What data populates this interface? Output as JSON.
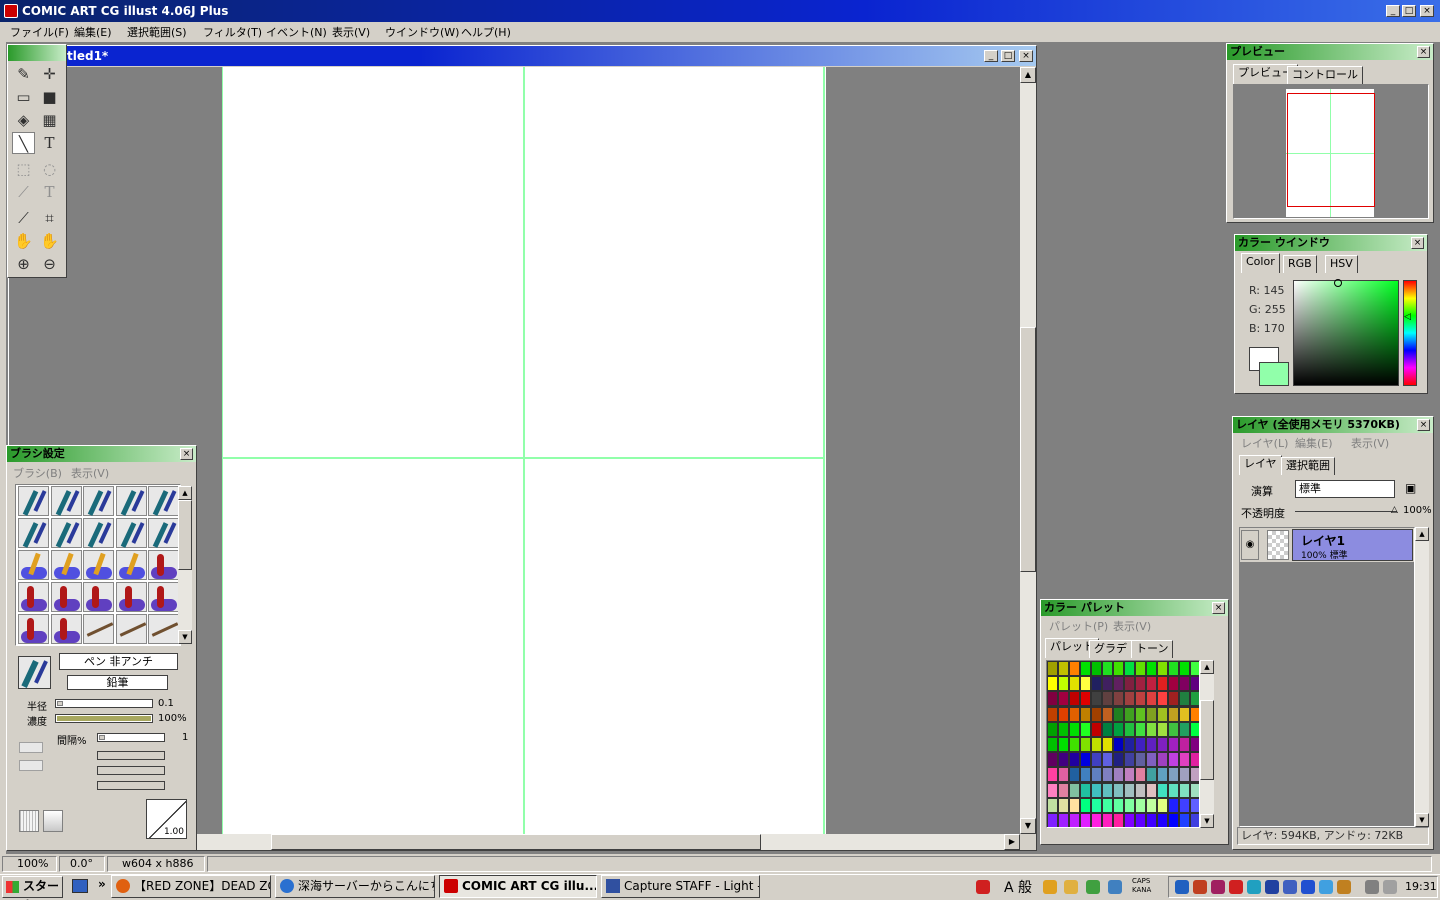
{
  "app": {
    "title": "COMIC ART CG illust 4.06J Plus",
    "menu": [
      "ファイル(F)",
      "編集(E)",
      "選択範囲(S)",
      "フィルタ(T)",
      "イベント(N)",
      "表示(V)",
      "ウインドウ(W)",
      "ヘルプ(H)"
    ]
  },
  "doc": {
    "title": "tled1*"
  },
  "status": {
    "zoom": "100%",
    "angle": "0.0°",
    "size": "w604 x h886"
  },
  "preview": {
    "title": "プレビュー",
    "tabs": [
      "プレビュー",
      "コントロール"
    ]
  },
  "color": {
    "title": "カラー ウインドウ",
    "tabs": [
      "Color",
      "RGB",
      "HSV"
    ],
    "r": "R: 145",
    "g": "G: 255",
    "b": "B: 170",
    "current": "#91ffaa"
  },
  "layer": {
    "title": "レイヤ (全使用メモリ 5370KB)",
    "menu": [
      "レイヤ(L)",
      "編集(E)",
      "表示(V)"
    ],
    "tabs": [
      "レイヤ",
      "選択範囲"
    ],
    "mode_label": "演算",
    "mode_value": "標準",
    "opacity_label": "不透明度",
    "opacity_value": "100%",
    "item_name": "レイヤ1",
    "item_info": "100% 標準",
    "footer": "レイヤ: 594KB, アンドゥ: 72KB"
  },
  "brush": {
    "title": "ブラシ設定",
    "menu": [
      "ブラシ(B)",
      "表示(V)"
    ],
    "name": "ペン 非アンチ",
    "sub": "鉛筆",
    "radius_label": "半径",
    "radius_value": "0.1",
    "density_label": "濃度",
    "density_value": "100%",
    "interval_label": "間隔%",
    "interval_value": "1",
    "curve_value": "1.00"
  },
  "palette": {
    "title": "カラー パレット",
    "menu": [
      "パレット(P)",
      "表示(V)"
    ],
    "tabs": [
      "パレット",
      "グラデ",
      "トーン"
    ]
  },
  "taskbar": {
    "start": "スタート",
    "tasks": [
      "【RED ZONE】DEAD ZO...",
      "深海サーバーからこんにち...",
      "COMIC ART CG illu...",
      "Capture STAFF - Light -"
    ],
    "ime": "A 般",
    "clock": "19:31"
  }
}
